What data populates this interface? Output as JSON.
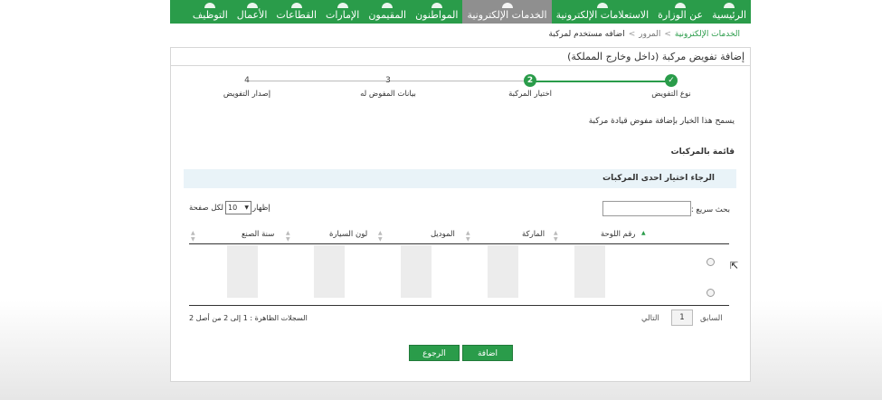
{
  "nav": {
    "items": [
      "الرئيسية",
      "عن الوزارة",
      "الاستعلامات الإلكترونية",
      "الخدمات الإلكترونية",
      "المواطنون",
      "المقيمون",
      "الإمارات",
      "القطاعات",
      "الأعمال",
      "التوظيف"
    ],
    "active_index": 3,
    "color": "#2a9c4a",
    "active_color": "#8f8f8f"
  },
  "breadcrumb": {
    "items": [
      "الخدمات الإلكترونية",
      "المرور",
      "اضافه مستخدم لمركبة"
    ],
    "separator": "<"
  },
  "panel": {
    "title": "إضافة تفويض مركبة (داخل وخارج المملكة)"
  },
  "wizard": {
    "steps": [
      {
        "number": "1",
        "label": "نوع التفويض",
        "state": "done"
      },
      {
        "number": "2",
        "label": "اختيار المركبة",
        "state": "current"
      },
      {
        "number": "3",
        "label": "بيانات المفوض له",
        "state": "pending"
      },
      {
        "number": "4",
        "label": "إصدار التفويض",
        "state": "pending"
      }
    ]
  },
  "hint": "يسمح هذا الخيار بإضافة مفوض قيادة مركبة",
  "list_title": "قائمة بالمركبات",
  "select_prompt": "الرجاء اختيار احدى المركبات",
  "table": {
    "search_label": "بحث سريع :",
    "search_value": "",
    "show_label": "إظهار",
    "page_size": "10",
    "entries_label": "لكل صفحة",
    "columns": [
      "رقم اللوحة",
      "الماركة",
      "الموديل",
      "لون السيارة",
      "سنة الصنع"
    ],
    "rows": [
      {
        "plate": "",
        "make": "",
        "model": "",
        "color": "",
        "year": ""
      },
      {
        "plate": "",
        "make": "",
        "model": "",
        "color": "",
        "year": ""
      }
    ],
    "prev_label": "السابق",
    "current_page": "1",
    "next_label": "التالي",
    "records_info": "السجلات الظاهرة : 1 إلى 2 من أصل 2"
  },
  "buttons": {
    "add": "اضافة",
    "back": "الرجوع"
  }
}
